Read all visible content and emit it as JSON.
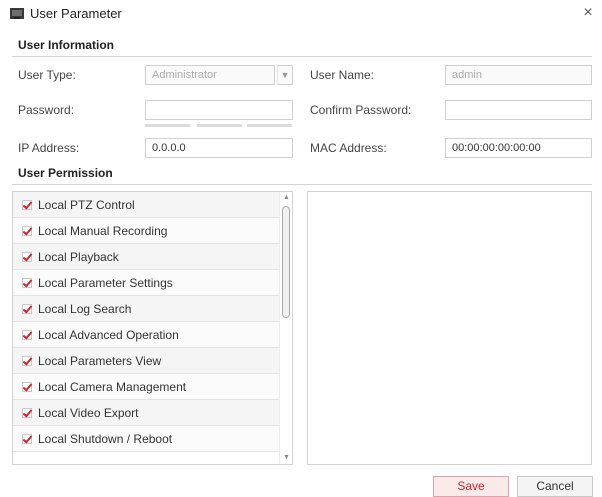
{
  "window": {
    "title": "User Parameter",
    "close_glyph": "×"
  },
  "user_information": {
    "section_title": "User Information",
    "user_type_label": "User Type:",
    "user_type_value": "Administrator",
    "user_name_label": "User Name:",
    "user_name_value": "admin",
    "password_label": "Password:",
    "password_value": "",
    "confirm_password_label": "Confirm Password:",
    "confirm_password_value": "",
    "ip_address_label": "IP Address:",
    "ip_address_value": "0.0.0.0",
    "mac_address_label": "MAC Address:",
    "mac_address_value": "00:00:00:00:00:00"
  },
  "user_permission": {
    "section_title": "User Permission",
    "items": [
      {
        "label": "Local PTZ Control",
        "checked": true
      },
      {
        "label": "Local Manual Recording",
        "checked": true
      },
      {
        "label": "Local Playback",
        "checked": true
      },
      {
        "label": "Local Parameter Settings",
        "checked": true
      },
      {
        "label": "Local Log Search",
        "checked": true
      },
      {
        "label": "Local Advanced Operation",
        "checked": true
      },
      {
        "label": "Local Parameters View",
        "checked": true
      },
      {
        "label": "Local Camera Management",
        "checked": true
      },
      {
        "label": "Local Video Export",
        "checked": true
      },
      {
        "label": "Local Shutdown / Reboot",
        "checked": true
      }
    ]
  },
  "buttons": {
    "save_label": "Save",
    "cancel_label": "Cancel"
  },
  "colors": {
    "accent": "#d2232a"
  }
}
